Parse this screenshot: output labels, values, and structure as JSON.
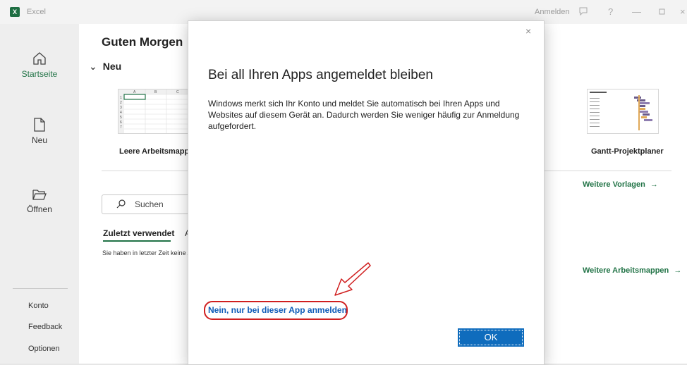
{
  "app": {
    "title": "Excel",
    "signin_label": "Anmelden"
  },
  "sidebar": {
    "items": [
      {
        "label": "Startseite"
      },
      {
        "label": "Neu"
      },
      {
        "label": "Öffnen"
      }
    ],
    "bottom": [
      {
        "label": "Konto"
      },
      {
        "label": "Feedback"
      },
      {
        "label": "Optionen"
      }
    ]
  },
  "home": {
    "greeting": "Guten Morgen",
    "new_section": "Neu",
    "templates": [
      {
        "label": "Leere Arbeitsmappe"
      },
      {
        "label": "Gantt-Projektplaner"
      }
    ],
    "more_templates": "Weitere Vorlagen",
    "more_workbooks": "Weitere Arbeitsmappen",
    "search_placeholder": "Suchen",
    "recent_tab": "Zuletzt verwendet",
    "recent_tab2_partial": "A",
    "recent_empty": "Sie haben in letzter Zeit keine A"
  },
  "dialog": {
    "title": "Bei all Ihren Apps angemeldet bleiben",
    "body": "Windows merkt sich Ihr Konto und meldet Sie automatisch bei Ihren Apps und Websites auf diesem Gerät an. Dadurch werden Sie weniger häufig zur Anmeldung aufgefordert.",
    "alt_link": "Nein, nur bei dieser App anmelden",
    "ok_label": "OK",
    "close_symbol": "×"
  },
  "colors": {
    "accent": "#217346",
    "link": "#0f5cb8",
    "primary_button": "#0f6cbd",
    "annotation": "#d01f1f"
  }
}
